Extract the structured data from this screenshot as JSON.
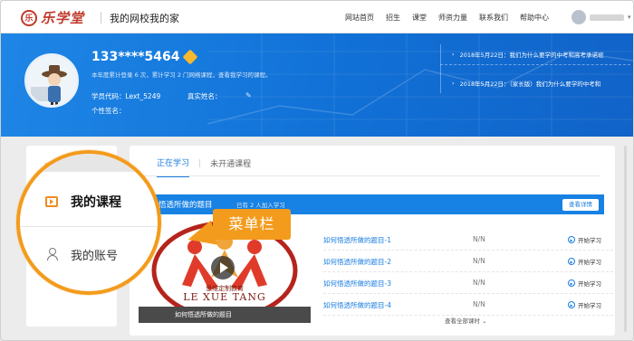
{
  "header": {
    "logo_text": "乐学堂",
    "logo_seal": "乐",
    "site_title": "我的网校我的家",
    "menu": [
      "网站首页",
      "招生",
      "课堂",
      "师资力量",
      "联系我们",
      "帮助中心"
    ]
  },
  "profile": {
    "phone": "133****5464",
    "stats": "本年度累计登录 6 次，累计学习 2 门网络课程，查看我学习的课程。",
    "student_id_label": "学员代码：",
    "student_id": "Lext_5249",
    "realname_label": "真实姓名：",
    "signature_label": "个性签名："
  },
  "news": [
    {
      "arrow": "›",
      "text": "2018年5月22日：我们为什么要学的中考和高考承诺班"
    },
    {
      "arrow": "›",
      "text": "2018年5月22日：（家长版）我们为什么要学的中考和"
    }
  ],
  "tabs": {
    "active": "正在学习",
    "separator": "|",
    "inactive": "未开通课程"
  },
  "course": {
    "title": "悟透所做的题目",
    "count": "已有 2 人加入学习",
    "detail_button": "查看详情",
    "thumb_caption": "如何悟透所做的题目",
    "thumb_brand_cn": "思维定制教育",
    "thumb_brand_en": "LE XUE TANG",
    "lessons": [
      {
        "name": "如何悟透所做的题目-1",
        "progress": "N/N",
        "action": "开始学习"
      },
      {
        "name": "如何悟透所做的题目-2",
        "progress": "N/N",
        "action": "开始学习"
      },
      {
        "name": "如何悟透所做的题目-3",
        "progress": "N/N",
        "action": "开始学习"
      },
      {
        "name": "如何悟透所做的题目-4",
        "progress": "N/N",
        "action": "开始学习"
      }
    ],
    "view_all": "查看全部课时 ⌄"
  },
  "sidebar": {
    "items": [
      {
        "label": "我的课程",
        "icon": "video-course-icon"
      },
      {
        "label": "我的账号",
        "icon": "user-icon"
      }
    ]
  },
  "callout": {
    "label": "菜单栏"
  },
  "colors": {
    "accent": "#1a7de0",
    "banner": "#1170d6",
    "highlight": "#f39b1c",
    "brand": "#c0392b"
  }
}
